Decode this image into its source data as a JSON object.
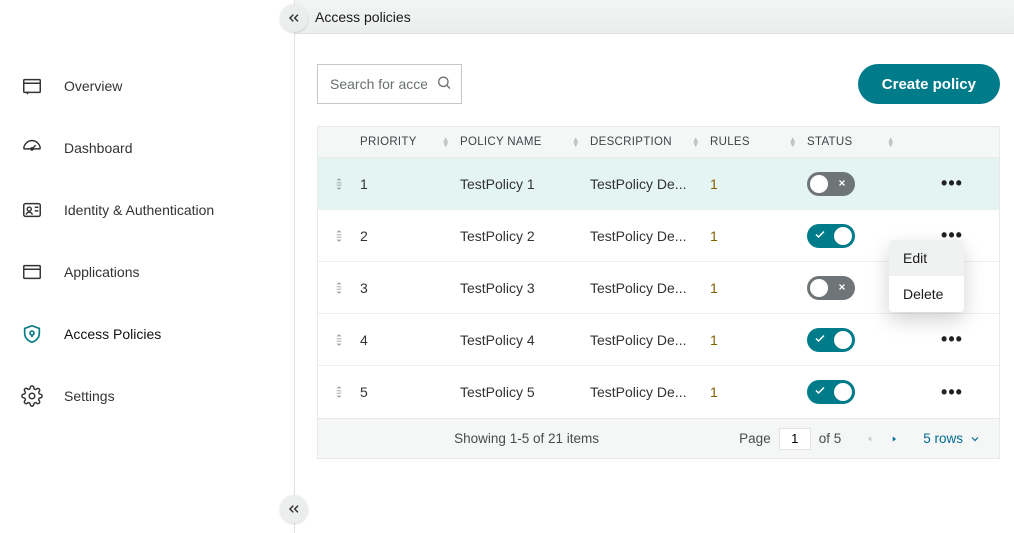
{
  "header": {
    "title": "Access policies"
  },
  "sidebar": {
    "items": [
      {
        "label": "Overview",
        "icon": "overview"
      },
      {
        "label": "Dashboard",
        "icon": "dashboard"
      },
      {
        "label": "Identity & Authentication",
        "icon": "identity"
      },
      {
        "label": "Applications",
        "icon": "applications"
      },
      {
        "label": "Access Policies",
        "icon": "access",
        "active": true
      },
      {
        "label": "Settings",
        "icon": "settings"
      }
    ]
  },
  "toolbar": {
    "search_placeholder": "Search for access policies",
    "create_label": "Create policy"
  },
  "table": {
    "columns": {
      "priority": "PRIORITY",
      "policy_name": "POLICY NAME",
      "description": "DESCRIPTION",
      "rules": "RULES",
      "status": "STATUS"
    },
    "rows": [
      {
        "priority": "1",
        "name": "TestPolicy 1",
        "description": "TestPolicy De...",
        "rules": "1",
        "status_on": false
      },
      {
        "priority": "2",
        "name": "TestPolicy 2",
        "description": "TestPolicy De...",
        "rules": "1",
        "status_on": true
      },
      {
        "priority": "3",
        "name": "TestPolicy 3",
        "description": "TestPolicy De...",
        "rules": "1",
        "status_on": false
      },
      {
        "priority": "4",
        "name": "TestPolicy 4",
        "description": "TestPolicy De...",
        "rules": "1",
        "status_on": true
      },
      {
        "priority": "5",
        "name": "TestPolicy 5",
        "description": "TestPolicy De...",
        "rules": "1",
        "status_on": true
      }
    ]
  },
  "row_menu": {
    "edit": "Edit",
    "delete": "Delete"
  },
  "footer": {
    "status": "Showing 1-5 of 21 items",
    "page_label": "Page",
    "page_value": "1",
    "page_of": "of 5",
    "rows_label": "5 rows"
  },
  "colors": {
    "accent": "#007b8a"
  }
}
